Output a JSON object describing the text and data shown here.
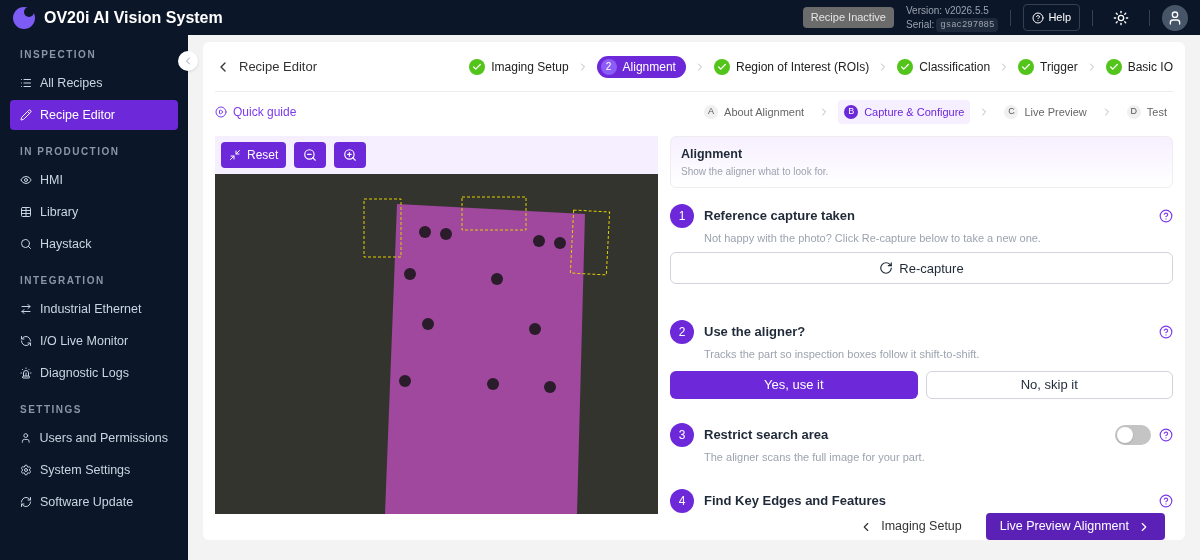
{
  "header": {
    "title": "OV20i AI Vision System",
    "status_badge": "Recipe Inactive",
    "version": "Version: v2026.5.5",
    "serial_label": "Serial:",
    "serial": "gsac297085",
    "help": "Help"
  },
  "sidebar": {
    "sections": [
      {
        "heading": "INSPECTION",
        "items": [
          {
            "label": "All Recipes",
            "selected": false
          },
          {
            "label": "Recipe Editor",
            "selected": true
          }
        ]
      },
      {
        "heading": "IN PRODUCTION",
        "items": [
          {
            "label": "HMI",
            "selected": false
          },
          {
            "label": "Library",
            "selected": false
          },
          {
            "label": "Haystack",
            "selected": false
          }
        ]
      },
      {
        "heading": "INTEGRATION",
        "items": [
          {
            "label": "Industrial Ethernet",
            "selected": false
          },
          {
            "label": "I/O Live Monitor",
            "selected": false
          },
          {
            "label": "Diagnostic Logs",
            "selected": false
          }
        ]
      },
      {
        "heading": "SETTINGS",
        "items": [
          {
            "label": "Users and Permissions",
            "selected": false
          },
          {
            "label": "System Settings",
            "selected": false
          },
          {
            "label": "Software Update",
            "selected": false
          }
        ]
      }
    ]
  },
  "breadcrumb": "Recipe Editor",
  "steps": [
    {
      "label": "Imaging Setup",
      "done": true,
      "selected": false
    },
    {
      "label": "Alignment",
      "number": "2",
      "done": false,
      "selected": true
    },
    {
      "label": "Region of Interest (ROIs)",
      "done": true,
      "selected": false
    },
    {
      "label": "Classification",
      "done": true,
      "selected": false
    },
    {
      "label": "Trigger",
      "done": true,
      "selected": false
    },
    {
      "label": "Basic IO",
      "done": true,
      "selected": false
    }
  ],
  "quick_guide": "Quick guide",
  "substeps": [
    {
      "letter": "A",
      "label": "About Alignment",
      "selected": false
    },
    {
      "letter": "B",
      "label": "Capture & Configure",
      "selected": true
    },
    {
      "letter": "C",
      "label": "Live Preview",
      "selected": false
    },
    {
      "letter": "D",
      "label": "Test",
      "selected": false
    }
  ],
  "image_toolbar": {
    "reset": "Reset"
  },
  "panel": {
    "title": "Alignment",
    "subtitle": "Show the aligner what to look for."
  },
  "sections": [
    {
      "kind": "capture",
      "number": "1",
      "title": "Reference capture taken",
      "description": "Not happy with the photo? Click Re-capture below to take a new one.",
      "button": "Re-capture"
    },
    {
      "kind": "choice",
      "number": "2",
      "title": "Use the aligner?",
      "description": "Tracks the part so inspection boxes follow it shift-to-shift.",
      "options": [
        {
          "label": "Yes, use it",
          "selected": true
        },
        {
          "label": "No, skip it",
          "selected": false
        }
      ]
    },
    {
      "kind": "toggle",
      "number": "3",
      "title": "Restrict search area",
      "description": "The aligner scans the full image for your part.",
      "on": false
    },
    {
      "kind": "heading",
      "number": "4",
      "title": "Find Key Edges and Features"
    }
  ],
  "footer": {
    "back": "Imaging Setup",
    "next": "Live Preview Alignment"
  }
}
